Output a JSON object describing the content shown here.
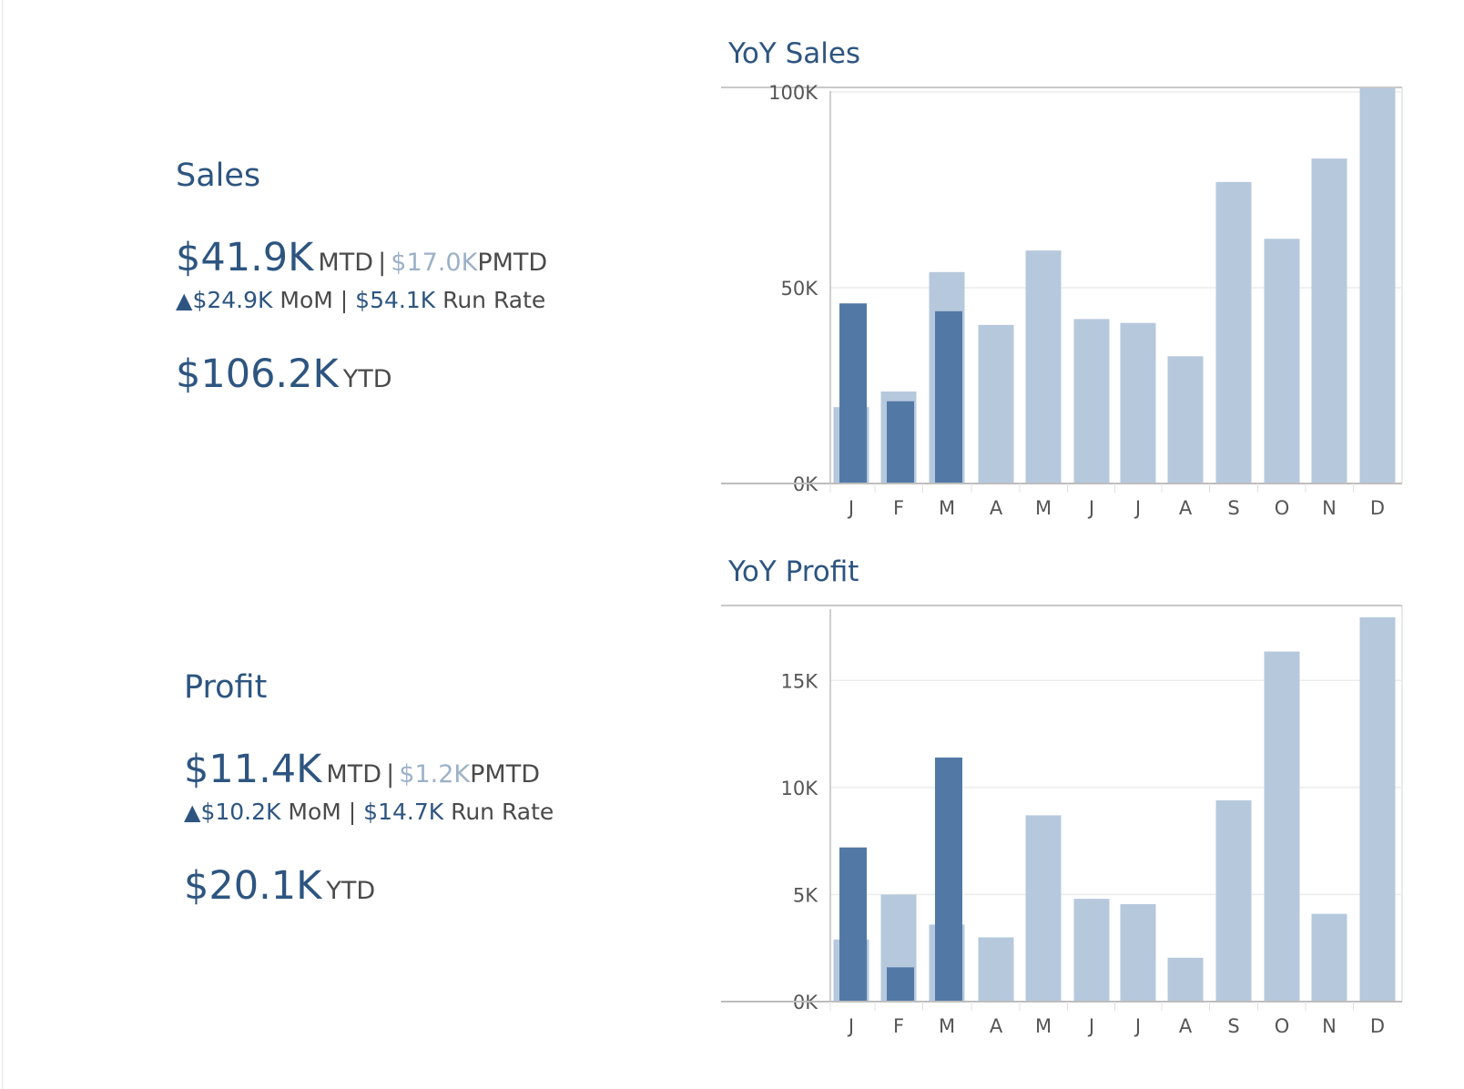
{
  "sales": {
    "title": "Sales",
    "mtd_value": "$41.9K",
    "mtd_label": "MTD",
    "separator": "|",
    "pmtd_value": "$17.0K",
    "pmtd_label": "PMTD",
    "mom_triangle": "▲",
    "mom_value": "$24.9K",
    "mom_label": "MoM",
    "runrate_value": "$54.1K",
    "runrate_label": "Run Rate",
    "ytd_value": "$106.2K",
    "ytd_label": "YTD"
  },
  "profit": {
    "title": "Profit",
    "mtd_value": "$11.4K",
    "mtd_label": "MTD",
    "separator": "|",
    "pmtd_value": "$1.2K",
    "pmtd_label": "PMTD",
    "mom_triangle": "▲",
    "mom_value": "$10.2K",
    "mom_label": "MoM",
    "runrate_value": "$14.7K",
    "runrate_label": "Run Rate",
    "ytd_value": "$20.1K",
    "ytd_label": "YTD"
  },
  "colors": {
    "current_year": "#5279a6",
    "prior_year": "#b6c8dc",
    "title": "#2d5580"
  },
  "chart_data": [
    {
      "type": "bar",
      "title": "YoY Sales",
      "categories": [
        "J",
        "F",
        "M",
        "A",
        "M",
        "J",
        "J",
        "A",
        "S",
        "O",
        "N",
        "D"
      ],
      "ylim": [
        0,
        100000
      ],
      "yticks": [
        {
          "value": 0,
          "label": "0K"
        },
        {
          "value": 50000,
          "label": "50K"
        },
        {
          "value": 100000,
          "label": "100K"
        }
      ],
      "grid": true,
      "series": [
        {
          "role": "prior",
          "values": [
            19500,
            23500,
            54000,
            40500,
            59500,
            42000,
            41000,
            32500,
            77000,
            62500,
            83000,
            101000
          ]
        },
        {
          "role": "current",
          "values": [
            46000,
            21000,
            44000,
            null,
            null,
            null,
            null,
            null,
            null,
            null,
            null,
            null
          ]
        }
      ]
    },
    {
      "type": "bar",
      "title": "YoY Profit",
      "categories": [
        "J",
        "F",
        "M",
        "A",
        "M",
        "J",
        "J",
        "A",
        "S",
        "O",
        "N",
        "D"
      ],
      "ylim": [
        0,
        18500
      ],
      "yticks": [
        {
          "value": 0,
          "label": "0K"
        },
        {
          "value": 5000,
          "label": "5K"
        },
        {
          "value": 10000,
          "label": "10K"
        },
        {
          "value": 15000,
          "label": "15K"
        }
      ],
      "grid": true,
      "series": [
        {
          "role": "prior",
          "values": [
            2900,
            5000,
            3600,
            3000,
            8700,
            4800,
            4550,
            2050,
            9400,
            16350,
            4100,
            17950
          ]
        },
        {
          "role": "current",
          "values": [
            7200,
            1600,
            11400,
            null,
            null,
            null,
            null,
            null,
            null,
            null,
            null,
            null
          ]
        }
      ]
    }
  ]
}
